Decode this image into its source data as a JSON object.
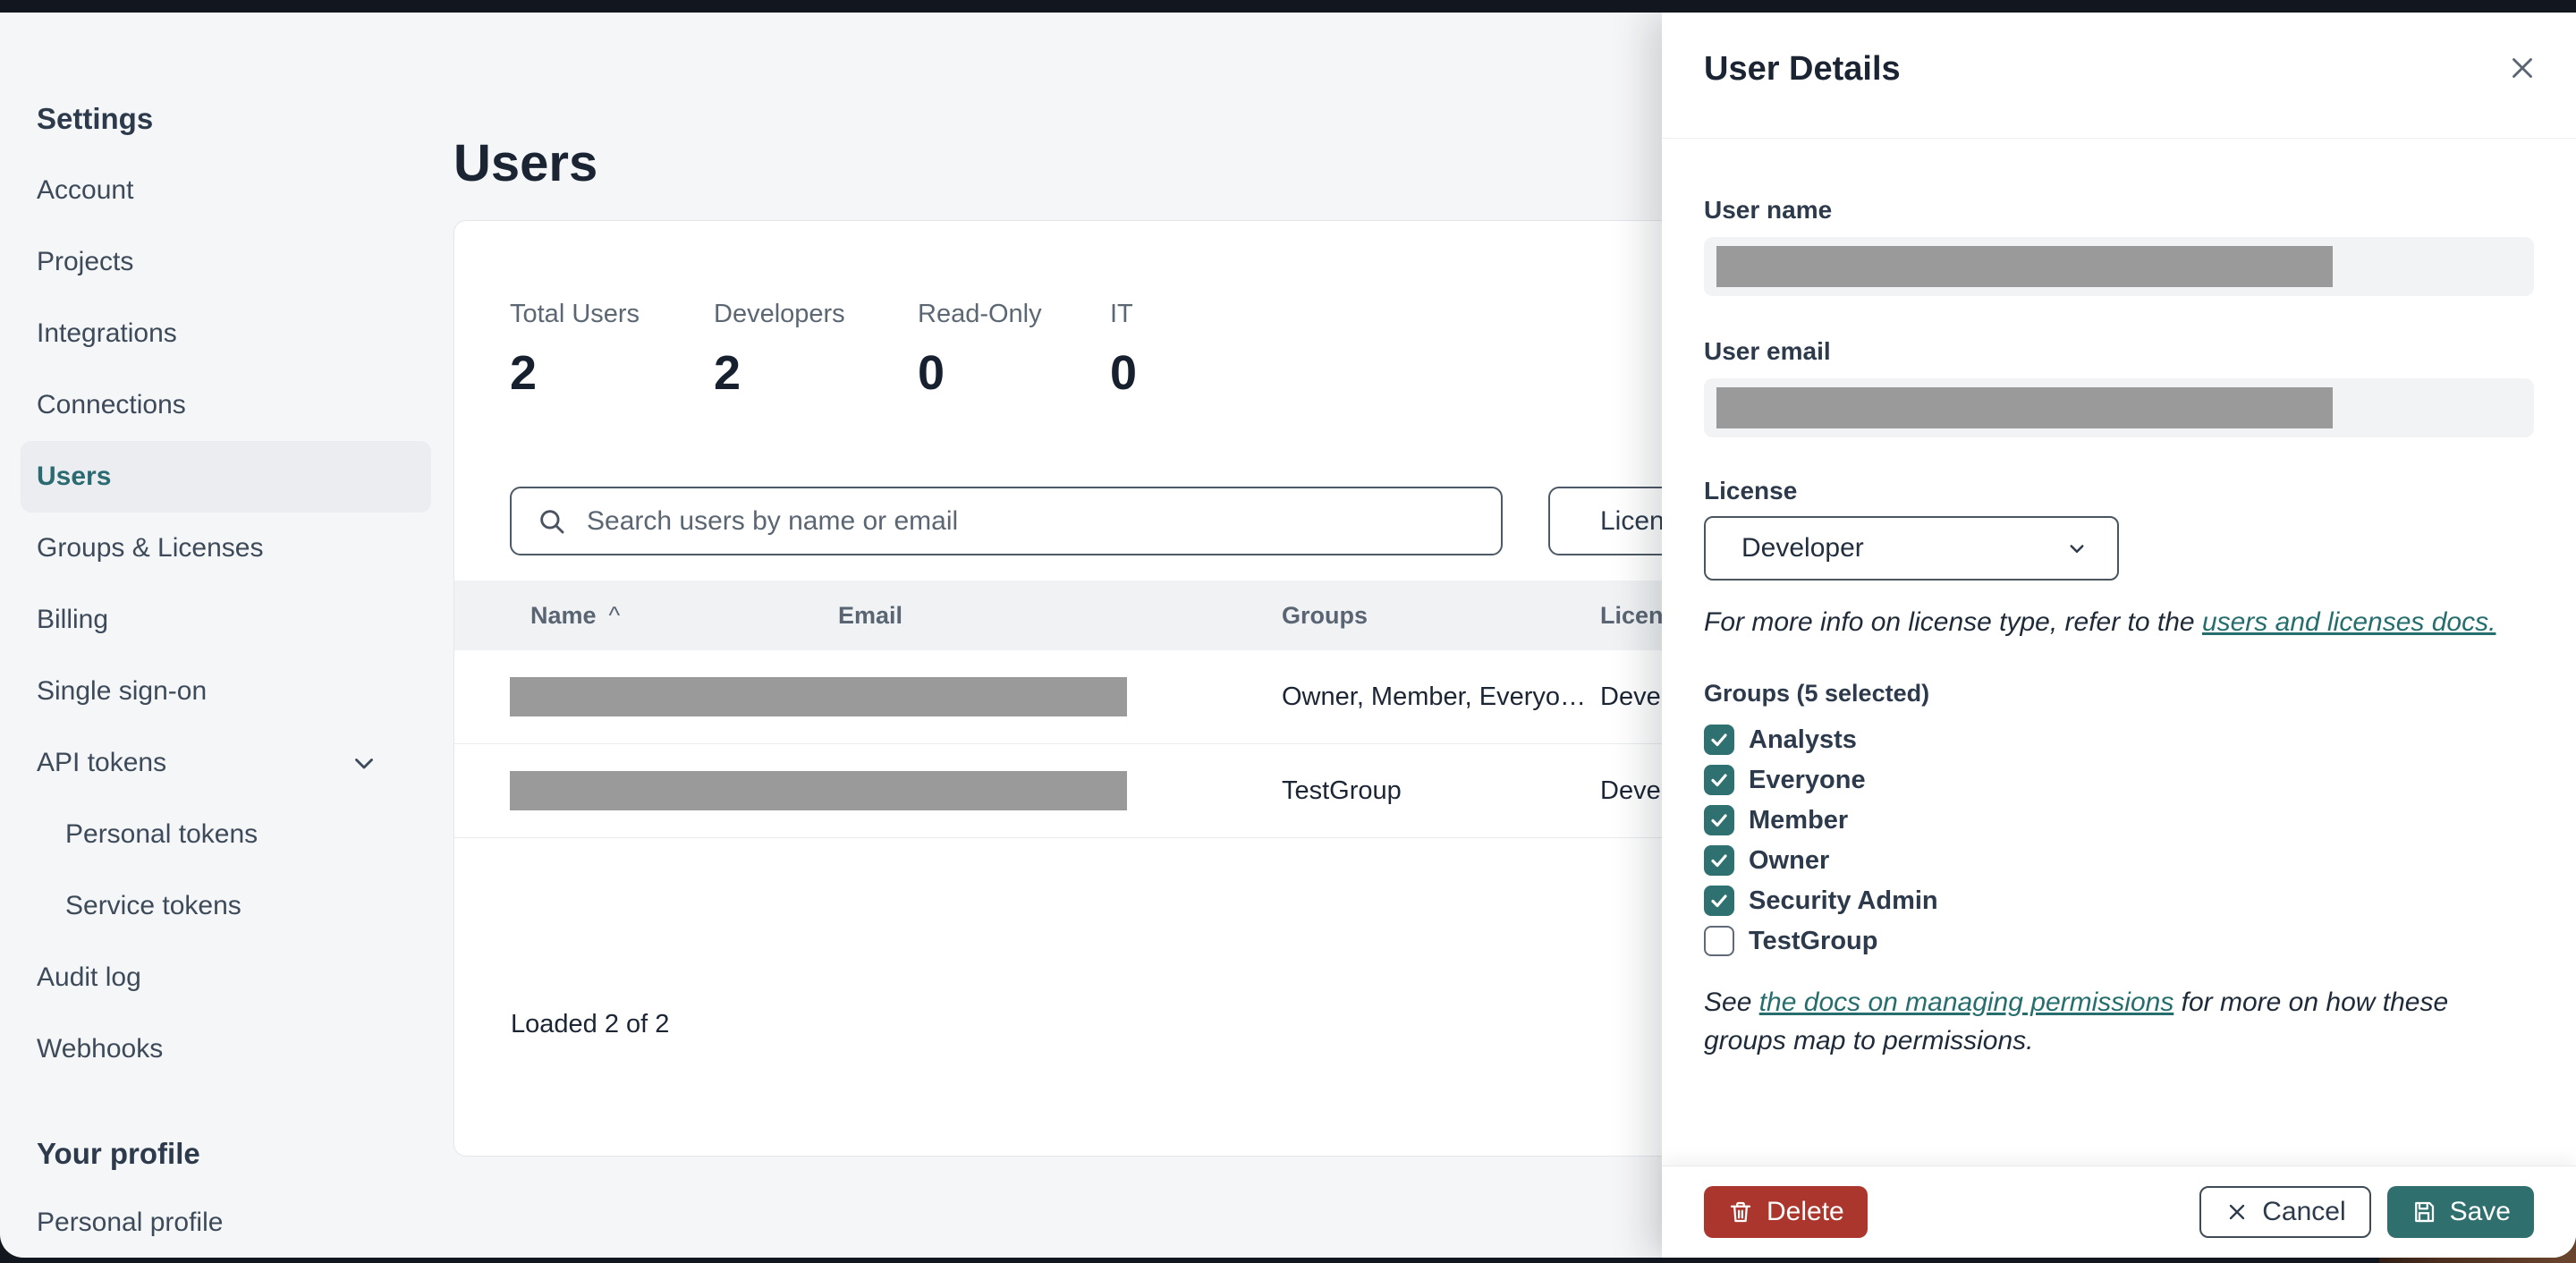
{
  "colors": {
    "accent_teal": "#2a6b72",
    "link_teal": "#256e6d",
    "checkbox_teal": "#2f7170",
    "delete_red": "#ab362d",
    "save_teal": "#2f6f6e",
    "redaction_gray": "#9a9a9a",
    "app_background": "#f5f6f8",
    "title_bar": "#11161f"
  },
  "sidebar": {
    "section_title": "Settings",
    "items": [
      {
        "label": "Account"
      },
      {
        "label": "Projects"
      },
      {
        "label": "Integrations"
      },
      {
        "label": "Connections"
      },
      {
        "label": "Users",
        "selected": true
      },
      {
        "label": "Groups & Licenses"
      },
      {
        "label": "Billing"
      },
      {
        "label": "Single sign-on"
      },
      {
        "label": "API tokens",
        "has_chevron": true
      },
      {
        "label": "Personal tokens",
        "indented": true
      },
      {
        "label": "Service tokens",
        "indented": true
      },
      {
        "label": "Audit log"
      },
      {
        "label": "Webhooks"
      }
    ],
    "profile_section_title": "Your profile",
    "profile_items": [
      {
        "label": "Personal profile"
      }
    ]
  },
  "main": {
    "title": "Users",
    "stats": [
      {
        "label": "Total Users",
        "value": "2"
      },
      {
        "label": "Developers",
        "value": "2"
      },
      {
        "label": "Read-Only",
        "value": "0"
      },
      {
        "label": "IT",
        "value": "0"
      }
    ],
    "search": {
      "placeholder": "Search users by name or email"
    },
    "license_filter_label": "License",
    "table": {
      "columns": {
        "name": "Name",
        "email": "Email",
        "groups": "Groups",
        "license": "License"
      },
      "sort_caret": "^",
      "rows": [
        {
          "name_redacted": true,
          "email_redacted": true,
          "groups": "Owner, Member, Everyo…",
          "license": "Developer"
        },
        {
          "name_redacted": true,
          "email_redacted": true,
          "groups": "TestGroup",
          "license": "Developer"
        }
      ],
      "footer_status": "Loaded 2 of 2"
    }
  },
  "panel": {
    "title": "User Details",
    "user_name_label": "User name",
    "user_email_label": "User email",
    "license_label": "License",
    "license_value": "Developer",
    "license_info_prefix": "For more info on license type, refer to the ",
    "license_info_link": "users and licenses docs.",
    "groups_label": "Groups (5 selected)",
    "groups": [
      {
        "label": "Analysts",
        "checked": true
      },
      {
        "label": "Everyone",
        "checked": true
      },
      {
        "label": "Member",
        "checked": true
      },
      {
        "label": "Owner",
        "checked": true
      },
      {
        "label": "Security Admin",
        "checked": true
      },
      {
        "label": "TestGroup",
        "checked": false
      }
    ],
    "note_prefix": "See ",
    "note_link": "the docs on managing permissions",
    "note_suffix": " for more on how these groups map to permissions.",
    "footer": {
      "delete_label": "Delete",
      "cancel_label": "Cancel",
      "save_label": "Save"
    }
  }
}
